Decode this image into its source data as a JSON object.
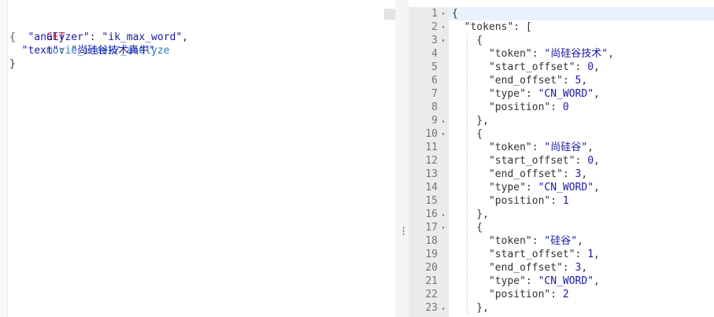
{
  "request": {
    "method": "GET",
    "path": "movie_index/_analyze",
    "lines": [
      {
        "open": "{",
        "key": "\"analyzer\"",
        "value": "\"ik_max_word\"",
        "trail": ","
      },
      {
        "key": "\"text\"",
        "value": "\"尚硅谷技术真牛\""
      },
      {
        "close": "}"
      }
    ]
  },
  "response": {
    "line_numbers": [
      "1",
      "2",
      "3",
      "4",
      "5",
      "6",
      "7",
      "8",
      "9",
      "10",
      "11",
      "12",
      "13",
      "14",
      "15",
      "16",
      "17",
      "18",
      "19",
      "20",
      "21",
      "22",
      "23"
    ],
    "lines": [
      "{",
      "  \"tokens\": [",
      "    {",
      "      \"token\": \"尚硅谷技术\",",
      "      \"start_offset\": 0,",
      "      \"end_offset\": 5,",
      "      \"type\": \"CN_WORD\",",
      "      \"position\": 0",
      "    },",
      "    {",
      "      \"token\": \"尚硅谷\",",
      "      \"start_offset\": 0,",
      "      \"end_offset\": 3,",
      "      \"type\": \"CN_WORD\",",
      "      \"position\": 1",
      "    },",
      "    {",
      "      \"token\": \"硅谷\",",
      "      \"start_offset\": 1,",
      "      \"end_offset\": 3,",
      "      \"type\": \"CN_WORD\",",
      "      \"position\": 2",
      "    },"
    ],
    "fold_markers": {
      "0": "▾",
      "1": "▾",
      "2": "▾",
      "8": "▴",
      "9": "▾",
      "15": "▴",
      "16": "▾",
      "22": "▴"
    }
  },
  "colors": {
    "method": "#c7254e",
    "path": "#2b7bb9",
    "string": "#1a1aa6",
    "gutter": "#ebebeb"
  }
}
